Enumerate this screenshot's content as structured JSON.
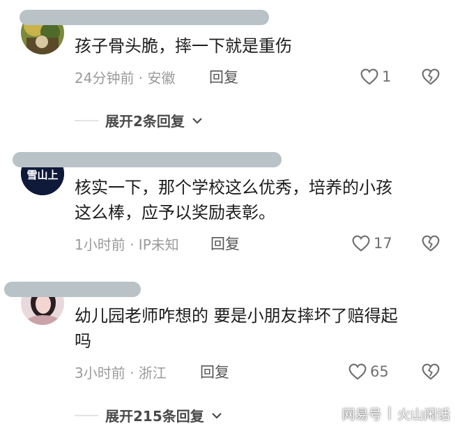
{
  "colors": {
    "redaction_bar": "#b9c2c6",
    "text_primary": "#1c1c1c",
    "text_meta": "#9a9a9a",
    "icon": "#707070"
  },
  "comments": [
    {
      "text_lines": [
        "孩子骨头脆，摔一下就是重伤"
      ],
      "meta": "24分钟前 · 安徽",
      "reply_label": "回复",
      "likes": "1",
      "expand_label": "展开2条回复"
    },
    {
      "avatar_text": "雪山上",
      "text_lines": [
        "核实一下，那个学校这么优秀，培养的小孩",
        "这么棒，应予以奖励表彰。"
      ],
      "meta": "1小时前 · IP未知",
      "reply_label": "回复",
      "likes": "17"
    },
    {
      "text_lines": [
        "幼儿园老师咋想的 要是小朋友摔坏了赔得起",
        "吗"
      ],
      "meta": "3小时前 · 浙江",
      "reply_label": "回复",
      "likes": "65",
      "expand_label": "展开215条回复"
    }
  ],
  "watermark": {
    "platform": "网易号",
    "separator": "|",
    "author": "火山闲话"
  }
}
